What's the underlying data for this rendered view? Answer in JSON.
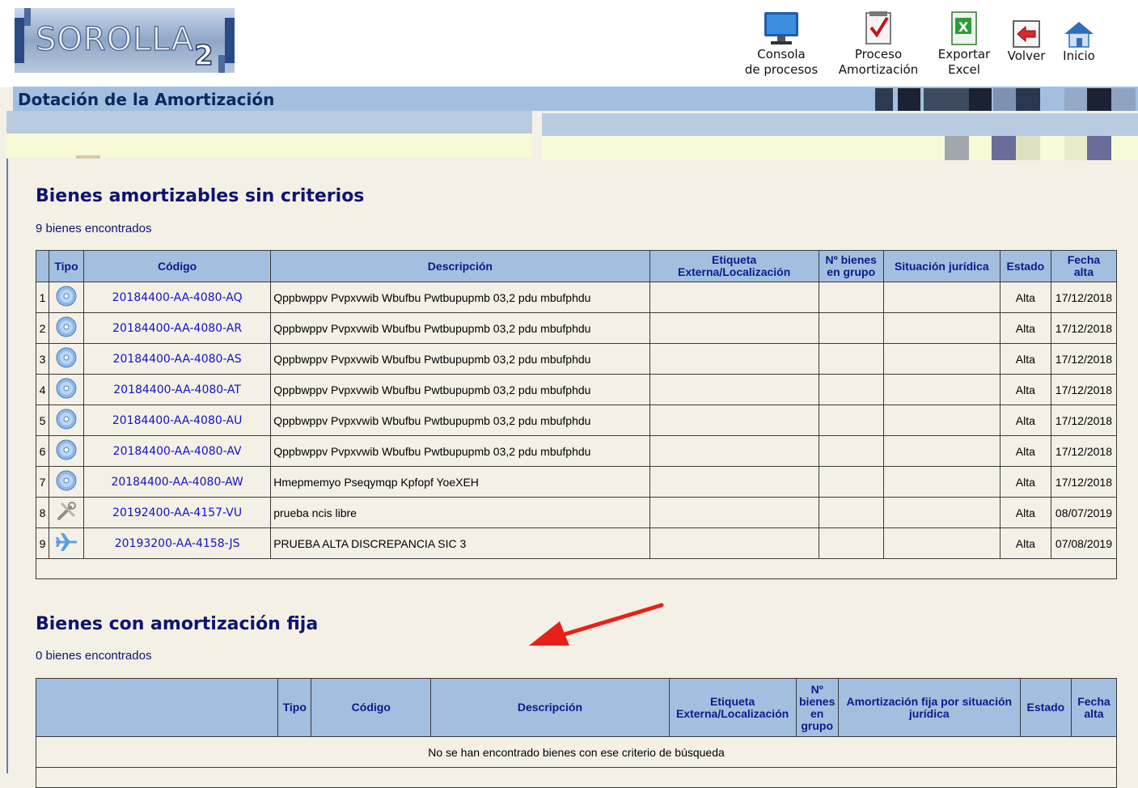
{
  "app": {
    "logo_text": "SOROLLA2"
  },
  "toolbar": [
    {
      "line1": "Consola",
      "line2": "de procesos",
      "icon": "monitor-icon"
    },
    {
      "line1": "Proceso",
      "line2": "Amortización",
      "icon": "checklist-icon"
    },
    {
      "line1": "Exportar",
      "line2": "Excel",
      "icon": "excel-icon"
    },
    {
      "line1": "Volver",
      "line2": "",
      "icon": "back-arrow-icon"
    },
    {
      "line1": "Inicio",
      "line2": "",
      "icon": "home-icon"
    }
  ],
  "page_title": "Dotación de la Amortización",
  "section1": {
    "title": "Bienes amortizables sin criterios",
    "count": "9 bienes encontrados",
    "headers": {
      "tipo": "Tipo",
      "codigo": "Código",
      "descripcion": "Descripción",
      "etiqueta_1": "Etiqueta",
      "etiqueta_2": "Externa/Localización",
      "nbienes_1": "Nº bienes",
      "nbienes_2": "en grupo",
      "situacion": "Situación jurídica",
      "estado": "Estado",
      "fecha_1": "Fecha",
      "fecha_2": "alta"
    },
    "rows": [
      {
        "n": "1",
        "icon": "cd-icon",
        "codigo": "20184400-AA-4080-AQ",
        "descripcion": "Qppbwppv Pvpxvwib Wbufbu Pwtbupupmb 03,2 pdu mbufphdu",
        "estado": "Alta",
        "fecha": "17/12/2018"
      },
      {
        "n": "2",
        "icon": "cd-icon",
        "codigo": "20184400-AA-4080-AR",
        "descripcion": "Qppbwppv Pvpxvwib Wbufbu Pwtbupupmb 03,2 pdu mbufphdu",
        "estado": "Alta",
        "fecha": "17/12/2018"
      },
      {
        "n": "3",
        "icon": "cd-icon",
        "codigo": "20184400-AA-4080-AS",
        "descripcion": "Qppbwppv Pvpxvwib Wbufbu Pwtbupupmb 03,2 pdu mbufphdu",
        "estado": "Alta",
        "fecha": "17/12/2018"
      },
      {
        "n": "4",
        "icon": "cd-icon",
        "codigo": "20184400-AA-4080-AT",
        "descripcion": "Qppbwppv Pvpxvwib Wbufbu Pwtbupupmb 03,2 pdu mbufphdu",
        "estado": "Alta",
        "fecha": "17/12/2018"
      },
      {
        "n": "5",
        "icon": "cd-icon",
        "codigo": "20184400-AA-4080-AU",
        "descripcion": "Qppbwppv Pvpxvwib Wbufbu Pwtbupupmb 03,2 pdu mbufphdu",
        "estado": "Alta",
        "fecha": "17/12/2018"
      },
      {
        "n": "6",
        "icon": "cd-icon",
        "codigo": "20184400-AA-4080-AV",
        "descripcion": "Qppbwppv Pvpxvwib Wbufbu Pwtbupupmb 03,2 pdu mbufphdu",
        "estado": "Alta",
        "fecha": "17/12/2018"
      },
      {
        "n": "7",
        "icon": "cd-icon",
        "codigo": "20184400-AA-4080-AW",
        "descripcion": "Hmepmemyo Pseqymqp Kpfopf YoeXEH",
        "estado": "Alta",
        "fecha": "17/12/2018"
      },
      {
        "n": "8",
        "icon": "tools-icon",
        "codigo": "20192400-AA-4157-VU",
        "descripcion": "prueba ncis libre",
        "estado": "Alta",
        "fecha": "08/07/2019"
      },
      {
        "n": "9",
        "icon": "airplane-icon",
        "codigo": "20193200-AA-4158-JS",
        "descripcion": "PRUEBA ALTA DISCREPANCIA SIC 3",
        "estado": "Alta",
        "fecha": "07/08/2019"
      }
    ]
  },
  "section2": {
    "title": "Bienes con amortización fija",
    "count": "0 bienes encontrados",
    "headers": {
      "tipo": "Tipo",
      "codigo": "Código",
      "descripcion": "Descripción",
      "etiqueta_1": "Etiqueta",
      "etiqueta_2": "Externa/Localización",
      "nbienes_1": "Nº",
      "nbienes_2": "bienes",
      "nbienes_3": "en",
      "nbienes_4": "grupo",
      "amort_1": "Amortización fija por situación",
      "amort_2": "jurídica",
      "estado": "Estado",
      "fecha_1": "Fecha",
      "fecha_2": "alta"
    },
    "empty_message": "No se han encontrado bienes con ese criterio de búsqueda"
  },
  "colors": {
    "header_blue": "#a3bfe0",
    "title_navy": "#0d1470",
    "link_blue": "#1313c8",
    "background": "#f4f0e6",
    "arrow_red": "#e8201a"
  }
}
